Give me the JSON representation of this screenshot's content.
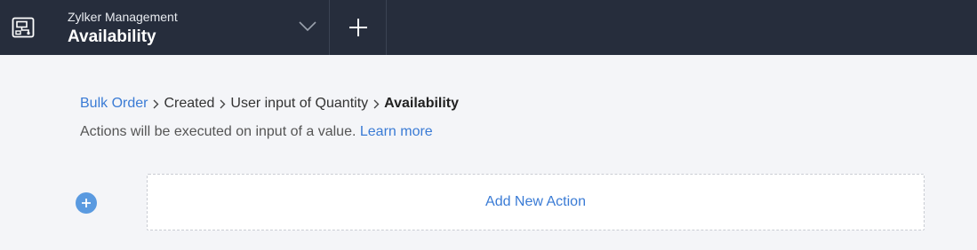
{
  "header": {
    "app_icon": "flow-diagram-icon",
    "subtitle": "Zylker Management",
    "title": "Availability",
    "dropdown_icon": "chevron-down-icon",
    "add_icon": "plus-icon"
  },
  "breadcrumb": {
    "items": [
      {
        "label": "Bulk Order",
        "link": true
      },
      {
        "label": "Created",
        "link": false
      },
      {
        "label": "User input of Quantity",
        "link": false
      },
      {
        "label": "Availability",
        "link": false,
        "current": true
      }
    ],
    "separator_icon": "chevron-right-icon"
  },
  "hint": {
    "text": "Actions will be executed on input of a value.",
    "link_label": "Learn more"
  },
  "action": {
    "add_icon": "plus-circle-icon",
    "add_label": "Add New Action"
  },
  "colors": {
    "topbar": "#262d3c",
    "page_bg": "#f4f5f8",
    "link": "#3a7bd5",
    "plus_circle": "#5a9ae0"
  }
}
